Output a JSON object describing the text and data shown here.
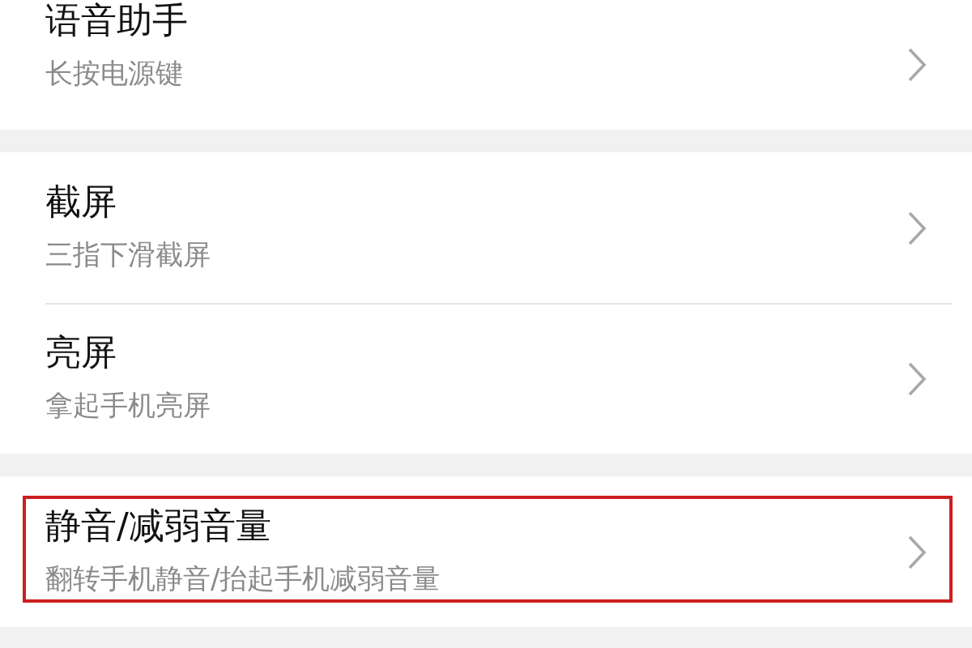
{
  "sections": [
    {
      "items": [
        {
          "title": "语音助手",
          "subtitle": "长按电源键",
          "highlighted": false
        }
      ]
    },
    {
      "items": [
        {
          "title": "截屏",
          "subtitle": "三指下滑截屏",
          "highlighted": false
        },
        {
          "title": "亮屏",
          "subtitle": "拿起手机亮屏",
          "highlighted": false
        }
      ]
    },
    {
      "items": [
        {
          "title": "静音/减弱音量",
          "subtitle": "翻转手机静音/抬起手机减弱音量",
          "highlighted": true
        }
      ]
    }
  ]
}
